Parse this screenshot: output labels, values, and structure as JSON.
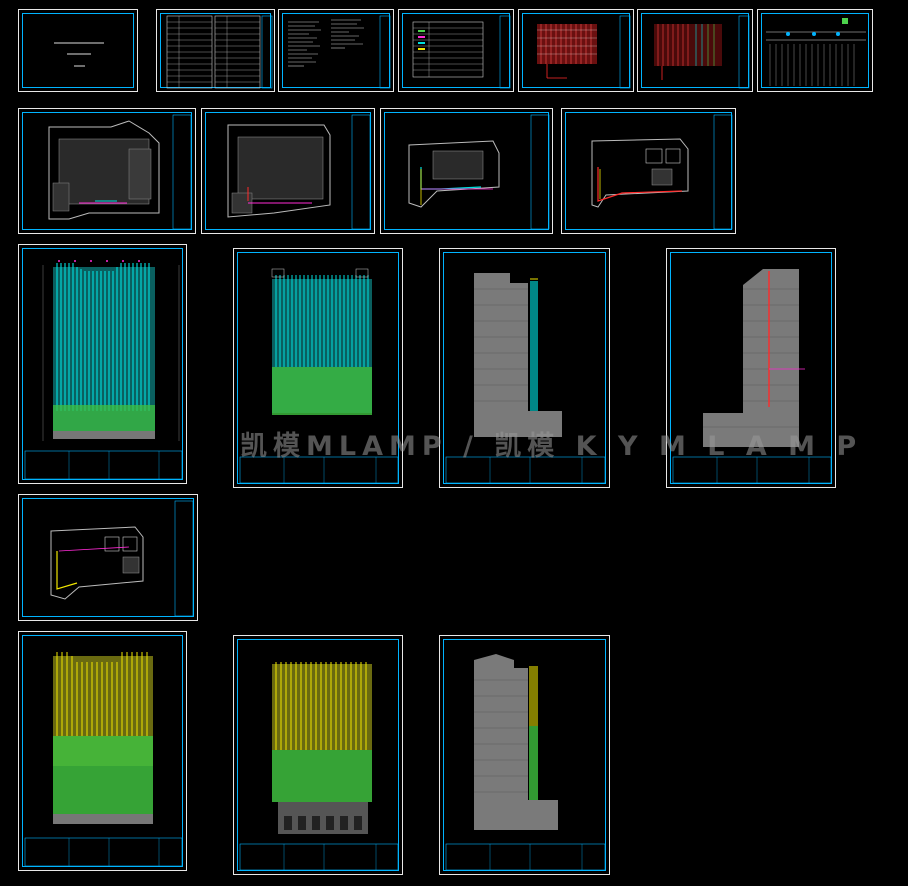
{
  "cover": {
    "line1": "",
    "line2": "",
    "line3": ""
  },
  "watermark": "凯模MLAMP / 凯模 K Y M L A M P",
  "colors": {
    "sheet_border": "#e8e8e8",
    "frame": "#00b4ff",
    "building": "#7a7a7a",
    "cyan": "#00e0e0",
    "green": "#4cd34c",
    "yellow": "#f1e600",
    "magenta": "#ff2bd6",
    "red": "#ff2a2a"
  }
}
